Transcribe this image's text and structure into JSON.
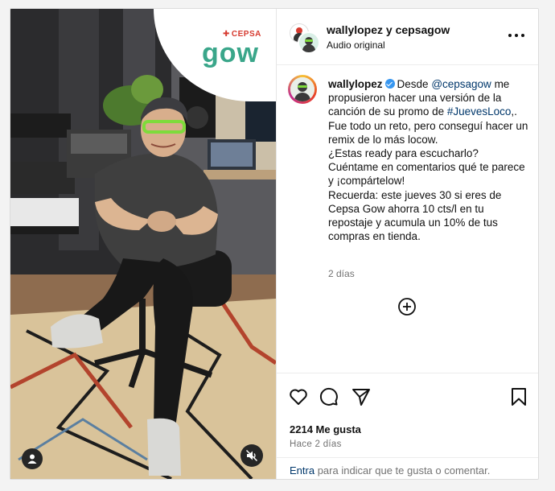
{
  "post": {
    "header": {
      "title": "wallylopez y cepsagow",
      "subtitle": "Audio original"
    },
    "media": {
      "brand_top": "CEPSA",
      "brand_main": "gow"
    },
    "caption": {
      "username": "wallylopez",
      "verified": true,
      "lead": "Desde ",
      "mention": "@cepsagow",
      "line_a": " me propusieron hacer una versión de la canción de su promo de ",
      "hashtag": "#JuevesLoco",
      "line_b": ",.\nFue todo un reto, pero conseguí hacer un remix de lo más locow.\n¿Estas ready para escucharlo?\nCuéntame en comentarios qué te parece y ¡compártelow!\nRecuerda: este jueves 30 si eres de Cepsa Gow ahorra 10 cts/l en tu repostaje y acumula un 10% de tus compras en tienda."
    },
    "caption_time": "2 días",
    "likes": "2214 Me gusta",
    "ago": "Hace 2 días",
    "login": {
      "link": "Entra",
      "text": " para indicar que te gusta o comentar."
    }
  },
  "icons": [
    "more-icon",
    "verified-icon",
    "add-comment-icon",
    "heart-icon",
    "comment-icon",
    "share-icon",
    "bookmark-icon",
    "user-tag-icon",
    "mute-icon"
  ],
  "colors": {
    "link": "#00376b",
    "verified": "#3897f0",
    "muted_text": "#737373",
    "cepsa_red": "#d63a2f",
    "gow_green": "#3aa68a"
  }
}
